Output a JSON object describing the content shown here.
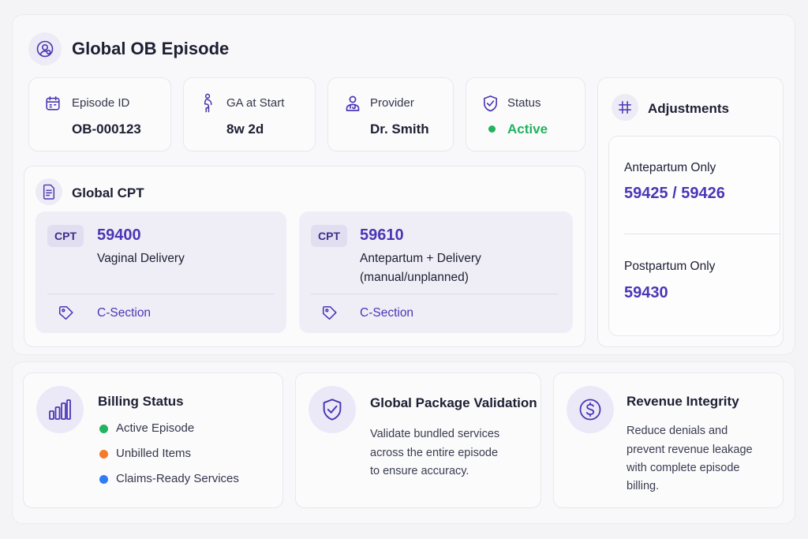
{
  "header": {
    "title": "Global OB Episode",
    "icon": "user-badge-icon"
  },
  "info_cards": [
    {
      "label": "Episode ID",
      "value": "OB-000123",
      "icon": "calendar-icon"
    },
    {
      "label": "GA at Start",
      "value": "8w 2d",
      "icon": "pregnant-person-icon"
    },
    {
      "label": "Provider",
      "value": "Dr. Smith",
      "icon": "doctor-icon"
    },
    {
      "label": "Status",
      "value": "Active",
      "icon": "shield-check-icon",
      "value_color": "#22b35e"
    }
  ],
  "global_cpt": {
    "title": "Global CPT",
    "icon": "document-icon",
    "badge": "CPT",
    "cards": [
      {
        "code": "59400",
        "description_lines": [
          "Vaginal Delivery"
        ],
        "modifier": "C-Section",
        "modifier_icon": "tag-icon"
      },
      {
        "code": "59610",
        "description_lines": [
          "Antepartum + Delivery",
          "(manual/unplanned)"
        ],
        "modifier": "C-Section",
        "modifier_icon": "tag-icon"
      }
    ]
  },
  "adjustments": {
    "title": "Adjustments",
    "icon": "grid-hash-icon",
    "items": [
      {
        "label": "Antepartum Only",
        "value": "59425 / 59426"
      },
      {
        "label": "Postpartum Only",
        "value": "59430"
      }
    ]
  },
  "billing_status": {
    "title": "Billing Status",
    "icon": "bar-chart-icon",
    "legend": [
      {
        "label": "Active Episode",
        "color": "#22b35e"
      },
      {
        "label": "Unbilled Items",
        "color": "#f47b2a"
      },
      {
        "label": "Claims-Ready Services",
        "color": "#2e7cf6"
      }
    ]
  },
  "package_validation": {
    "title": "Global Package Validation",
    "icon": "shield-check-icon",
    "text_lines": [
      "Validate bundled services",
      "across the entire episode",
      "to ensure accuracy."
    ]
  },
  "revenue_integrity": {
    "title": "Revenue Integrity",
    "icon": "dollar-circle-icon",
    "text_lines": [
      "Reduce denials and",
      "prevent revenue leakage",
      "with complete episode",
      "billing."
    ]
  },
  "colors": {
    "accent": "#4a36b5",
    "active": "#22b35e"
  }
}
